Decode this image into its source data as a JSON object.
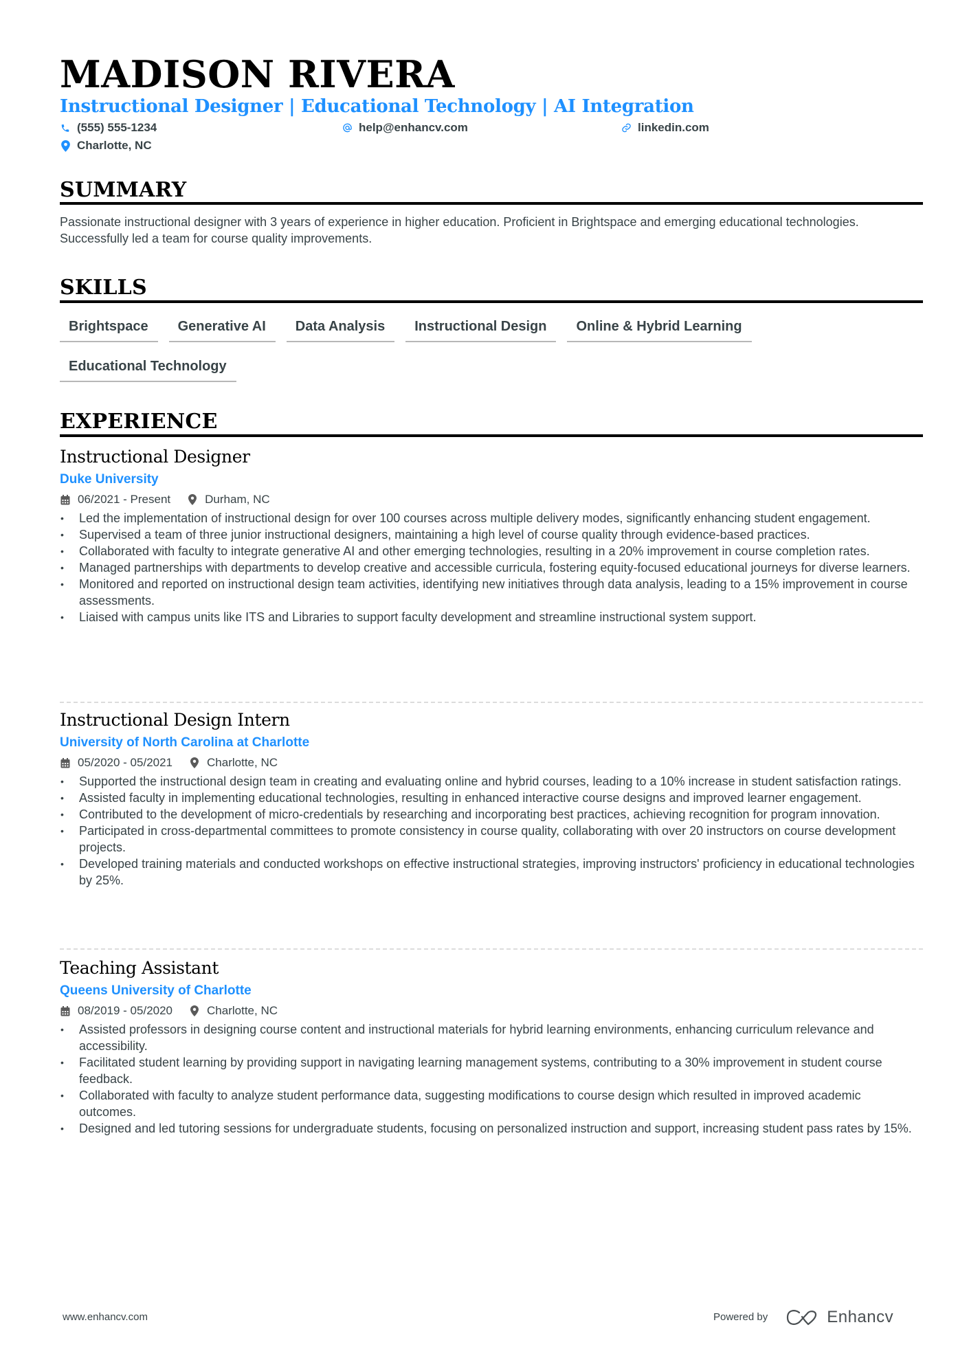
{
  "header": {
    "name": "MADISON RIVERA",
    "headline": "Instructional Designer | Educational Technology | AI Integration",
    "contacts": {
      "phone": {
        "icon": "phone-icon",
        "text": "(555) 555-1234"
      },
      "email": {
        "icon": "at-icon",
        "text": "help@enhancv.com"
      },
      "link": {
        "icon": "link-icon",
        "text": "linkedin.com"
      },
      "location": {
        "icon": "map-pin-icon",
        "text": "Charlotte, NC"
      }
    }
  },
  "summary": {
    "title": "SUMMARY",
    "text": "Passionate instructional designer with 3 years of experience in higher education. Proficient in Brightspace and emerging educational technologies. Successfully led a team for course quality improvements."
  },
  "skills": {
    "title": "SKILLS",
    "items": [
      "Brightspace",
      "Generative AI",
      "Data Analysis",
      "Instructional Design",
      "Online & Hybrid Learning",
      "Educational Technology"
    ]
  },
  "experience": {
    "title": "EXPERIENCE",
    "jobs": [
      {
        "title": "Instructional Designer",
        "company": "Duke University",
        "dates": "06/2021 - Present",
        "location": "Durham, NC",
        "bullets": [
          "Led the implementation of instructional design for over 100 courses across multiple delivery modes, significantly enhancing student engagement.",
          "Supervised a team of three junior instructional designers, maintaining a high level of course quality through evidence-based practices.",
          "Collaborated with faculty to integrate generative AI and other emerging technologies, resulting in a 20% improvement in course completion rates.",
          "Managed partnerships with departments to develop creative and accessible curricula, fostering equity-focused educational journeys for diverse learners.",
          "Monitored and reported on instructional design team activities, identifying new initiatives through data analysis, leading to a 15% improvement in course assessments.",
          "Liaised with campus units like ITS and Libraries to support faculty development and streamline instructional system support."
        ]
      },
      {
        "title": "Instructional Design Intern",
        "company": "University of North Carolina at Charlotte",
        "dates": "05/2020 - 05/2021",
        "location": "Charlotte, NC",
        "bullets": [
          "Supported the instructional design team in creating and evaluating online and hybrid courses, leading to a 10% increase in student satisfaction ratings.",
          "Assisted faculty in implementing educational technologies, resulting in enhanced interactive course designs and improved learner engagement.",
          "Contributed to the development of micro-credentials by researching and incorporating best practices, achieving recognition for program innovation.",
          "Participated in cross-departmental committees to promote consistency in course quality, collaborating with over 20 instructors on course development projects.",
          "Developed training materials and conducted workshops on effective instructional strategies, improving instructors' proficiency in educational technologies by 25%."
        ]
      },
      {
        "title": "Teaching Assistant",
        "company": "Queens University of Charlotte",
        "dates": "08/2019 - 05/2020",
        "location": "Charlotte, NC",
        "bullets": [
          "Assisted professors in designing course content and instructional materials for hybrid learning environments, enhancing curriculum relevance and accessibility.",
          "Facilitated student learning by providing support in navigating learning management systems, contributing to a 30% improvement in student course feedback.",
          "Collaborated with faculty to analyze student performance data, suggesting modifications to course design which resulted in improved academic outcomes.",
          "Designed and led tutoring sessions for undergraduate students, focusing on personalized instruction and support, increasing student pass rates by 15%."
        ]
      }
    ]
  },
  "footer": {
    "website": "www.enhancv.com",
    "powered_by": "Powered by",
    "brand": "Enhancv",
    "brand_icon": "enhancv-logo-icon"
  },
  "colors": {
    "accent": "#1e90ff",
    "text": "#384347",
    "heading": "#000000",
    "chip_underline": "#b7b7b7",
    "separator": "#dcdcdc"
  }
}
